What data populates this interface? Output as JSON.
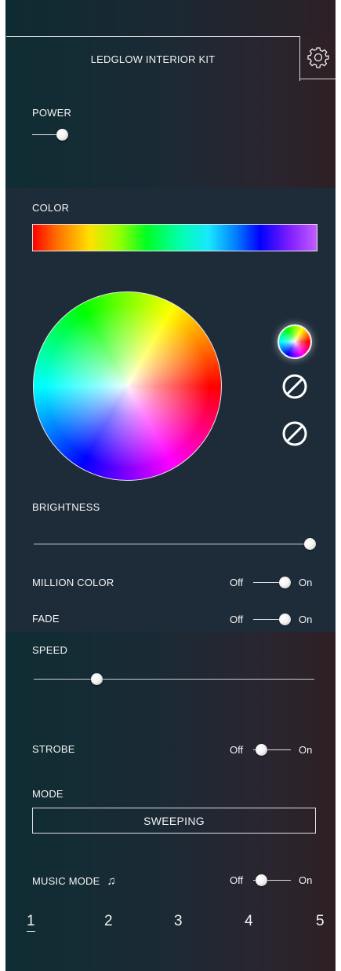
{
  "header": {
    "title": "LEDGLOW INTERIOR KIT",
    "settings_icon": "gear-icon"
  },
  "power": {
    "label": "POWER",
    "state": "on"
  },
  "color": {
    "label": "COLOR",
    "spectrum_colors": [
      "#ff0000",
      "#ffe100",
      "#00ff22",
      "#18e7ff",
      "#0000ff",
      "#c35cff"
    ],
    "favorites": [
      {
        "type": "custom-color",
        "icon": "color-wheel-icon"
      },
      {
        "type": "empty",
        "icon": "prohibited-icon"
      },
      {
        "type": "empty",
        "icon": "prohibited-icon"
      }
    ]
  },
  "brightness": {
    "label": "BRIGHTNESS",
    "level": 1.0
  },
  "million_color": {
    "label": "MILLION COLOR",
    "off": "Off",
    "on": "On",
    "state": "on"
  },
  "fade": {
    "label": "FADE",
    "off": "Off",
    "on": "On",
    "state": "on"
  },
  "speed": {
    "label": "SPEED",
    "level": 0.22
  },
  "strobe": {
    "label": "STROBE",
    "off": "Off",
    "on": "On",
    "state": "off"
  },
  "mode": {
    "label": "MODE",
    "value": "SWEEPING"
  },
  "music_mode": {
    "label": "MUSIC MODE",
    "icon": "music-note-icon",
    "off": "Off",
    "on": "On",
    "state": "off"
  },
  "zones": {
    "items": [
      "1",
      "2",
      "3",
      "4",
      "5"
    ],
    "active": "1"
  },
  "colors": {
    "accent": "#f2f2f2",
    "panel": "#1e2c3a"
  }
}
